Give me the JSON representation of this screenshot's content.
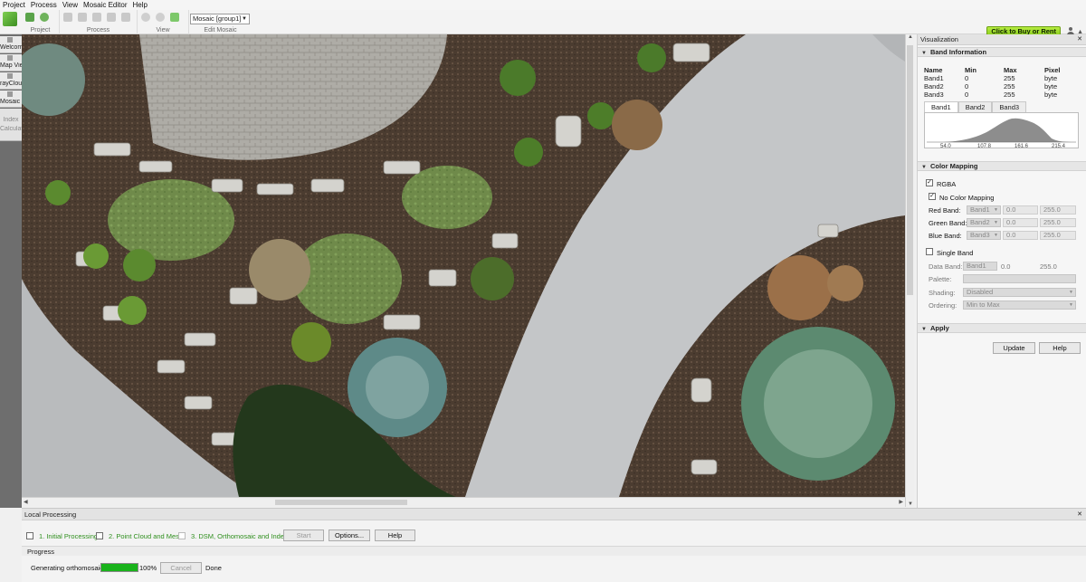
{
  "menu": [
    "Project",
    "Process",
    "View",
    "Mosaic Editor",
    "Help"
  ],
  "toolbar": {
    "groups": [
      "Project",
      "Process",
      "View",
      "Edit Mosaic"
    ],
    "mosaic_select": "Mosaic [group1]",
    "buy_label": "Click to Buy or Rent"
  },
  "sidebar": {
    "tabs": [
      "Welcome",
      "Map View",
      "rayCloud",
      "Mosaic Editor"
    ],
    "last_tab_line1": "Index",
    "last_tab_line2": "Calculator"
  },
  "visualization": {
    "title": "Visualization",
    "band_info": {
      "header": "Band Information",
      "columns": [
        "Name",
        "Min",
        "Max",
        "Pixel"
      ],
      "rows": [
        [
          "Band1",
          "0",
          "255",
          "byte"
        ],
        [
          "Band2",
          "0",
          "255",
          "byte"
        ],
        [
          "Band3",
          "0",
          "255",
          "byte"
        ]
      ],
      "tabs": [
        "Band1",
        "Band2",
        "Band3"
      ],
      "hist_ticks": [
        "54.0",
        "107.8",
        "161.6",
        "215.4"
      ]
    },
    "color_mapping": {
      "header": "Color Mapping",
      "rgba_label": "RGBA",
      "no_color_label": "No Color Mapping",
      "red_label": "Red Band:",
      "green_label": "Green Band:",
      "blue_label": "Blue Band:",
      "red_band": "Band1",
      "green_band": "Band2",
      "blue_band": "Band3",
      "min_value": "0.0",
      "max_value": "255.0",
      "single_band_label": "Single Band",
      "data_band_label": "Data Band:",
      "data_band": "Band1",
      "data_min": "0.0",
      "data_max": "255.0",
      "palette_label": "Palette:",
      "shading_label": "Shading:",
      "shading_value": "Disabled",
      "ordering_label": "Ordering:",
      "ordering_value": "Min to Max"
    },
    "apply": {
      "header": "Apply",
      "update_label": "Update",
      "help_label": "Help"
    }
  },
  "processing": {
    "title": "Local Processing",
    "steps": [
      "1. Initial Processing",
      "2. Point Cloud and Mesh",
      "3. DSM, Orthomosaic and Index"
    ],
    "start_label": "Start",
    "options_label": "Options...",
    "help_label": "Help",
    "progress_header": "Progress",
    "status_text": "Generating orthomosaic",
    "percent_text": "100%",
    "progress_fraction": 1.0,
    "cancel_label": "Cancel",
    "done_text": "Done"
  },
  "colors": {
    "accent_green": "#2f8f1e",
    "progress_green": "#19b31b",
    "buy_green": "#86c91c"
  }
}
